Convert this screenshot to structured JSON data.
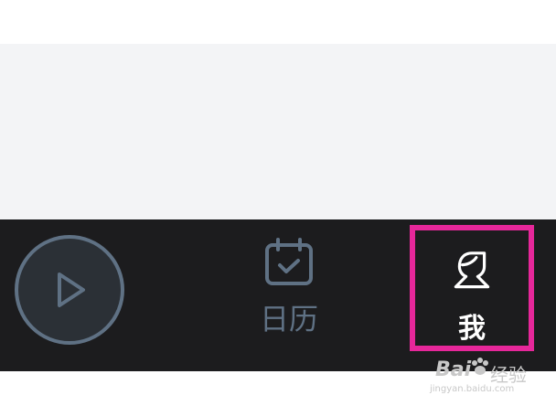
{
  "tabbar": {
    "play": {
      "icon": "play-icon"
    },
    "calendar": {
      "icon": "calendar-check-icon",
      "label": "日历"
    },
    "me": {
      "icon": "user-icon",
      "label": "我"
    }
  },
  "colors": {
    "tabbar_bg": "#1c1c1e",
    "inactive_icon": "#5f7184",
    "active": "#ffffff",
    "highlight": "#e6279a",
    "content_bg": "#f3f4f6"
  },
  "watermark": {
    "brand": "Bai",
    "text": "经验",
    "url": "jingyan.baidu.com"
  }
}
